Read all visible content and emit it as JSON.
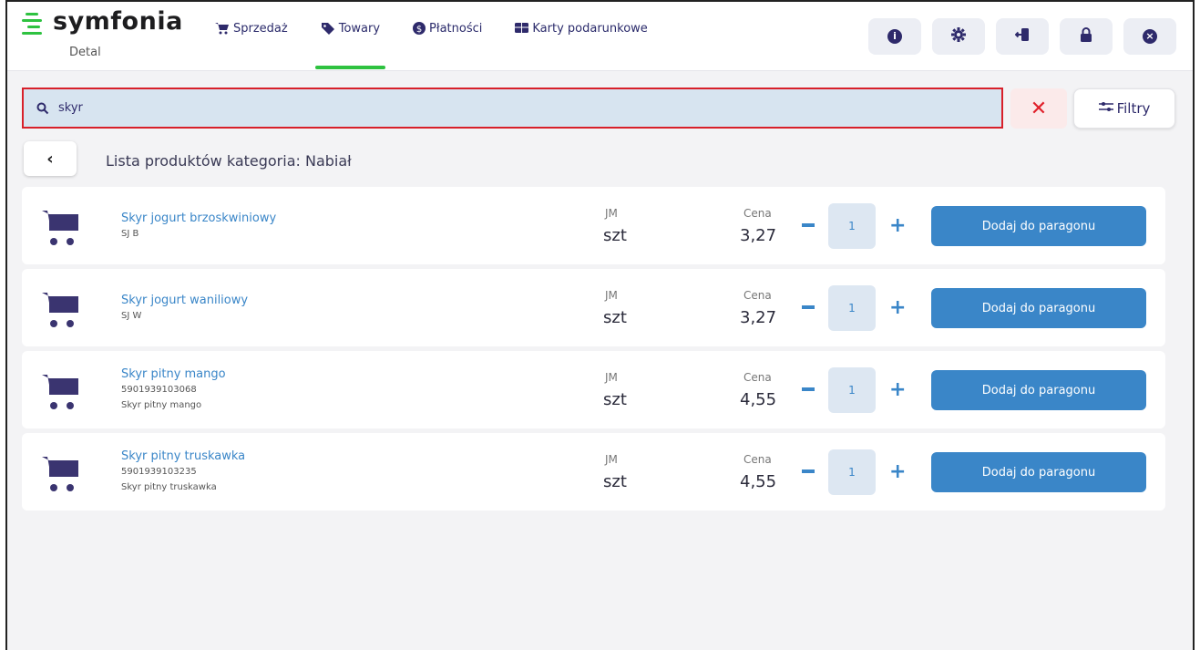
{
  "brand": {
    "name": "symfonia",
    "sub": "Detal",
    "accent": "#2ec240"
  },
  "nav": [
    {
      "label": "Sprzedaż",
      "icon": "cart-icon",
      "active": false
    },
    {
      "label": "Towary",
      "icon": "tag-icon",
      "active": true
    },
    {
      "label": "Płatności",
      "icon": "dollar-icon",
      "active": false
    },
    {
      "label": "Karty podarunkowe",
      "icon": "gift-card-icon",
      "active": false
    }
  ],
  "tools": [
    "info-icon",
    "gear-icon",
    "logout-icon",
    "lock-icon",
    "close-circle-icon"
  ],
  "search": {
    "value": "skyr",
    "placeholder": ""
  },
  "filter_label": "Filtry",
  "breadcrumb": {
    "title": "Lista produktów kategoria: Nabiał"
  },
  "labels": {
    "jm": "JM",
    "cena": "Cena",
    "add": "Dodaj do paragonu"
  },
  "products": [
    {
      "name": "Skyr jogurt brzoskwiniowy",
      "code": "SJ B",
      "desc": "",
      "unit": "szt",
      "price": "3,27",
      "qty": "1"
    },
    {
      "name": "Skyr jogurt waniliowy",
      "code": "SJ W",
      "desc": "",
      "unit": "szt",
      "price": "3,27",
      "qty": "1"
    },
    {
      "name": "Skyr pitny mango",
      "code": "5901939103068",
      "desc": "Skyr pitny mango",
      "unit": "szt",
      "price": "4,55",
      "qty": "1"
    },
    {
      "name": "Skyr pitny truskawka",
      "code": "5901939103235",
      "desc": "Skyr pitny truskawka",
      "unit": "szt",
      "price": "4,55",
      "qty": "1"
    }
  ]
}
